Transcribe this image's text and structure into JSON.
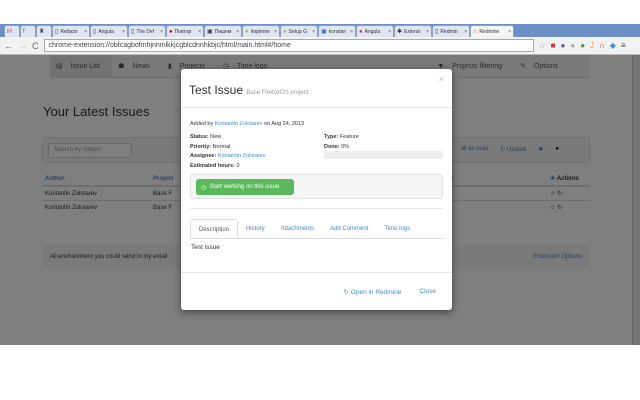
{
  "browser": {
    "tabs": [
      {
        "label": "",
        "icon": "M",
        "color": "#d44"
      },
      {
        "label": "",
        "icon": "f",
        "color": "#3b5998"
      },
      {
        "label": "",
        "icon": "♜",
        "color": "#335"
      },
      {
        "label": "Refacto",
        "icon": "▯"
      },
      {
        "label": "Angula",
        "icon": "▯"
      },
      {
        "label": "The Def",
        "icon": "▯"
      },
      {
        "label": "Повтор",
        "icon": "●",
        "color": "#c00"
      },
      {
        "label": "Пишем",
        "icon": "▣"
      },
      {
        "label": "Impleme",
        "icon": "●",
        "color": "#8c4"
      },
      {
        "label": "Setup G",
        "icon": "●",
        "color": "#8c4"
      },
      {
        "label": "konstan",
        "icon": "▣",
        "color": "#36c"
      },
      {
        "label": "Angula",
        "icon": "●",
        "color": "#c33"
      },
      {
        "label": "Extensi",
        "icon": "✱"
      },
      {
        "label": "Redmin",
        "icon": "▯"
      },
      {
        "label": "Redmine",
        "icon": "∩",
        "color": "#c33",
        "active": true
      }
    ],
    "url": "chrome-extension://obfcagbofmhjnnmlkkjcgblcdnnhkbjc/html/main.html#/home"
  },
  "nav": {
    "items": [
      "Issue List",
      "News",
      "Projects",
      "Time logs"
    ],
    "right": [
      "Projects filtering",
      "Options"
    ]
  },
  "page": {
    "title": "Your Latest Issues",
    "search_placeholder": "Search by subject",
    "mark_read": "all as read",
    "update": "Update",
    "columns": [
      "Author",
      "Project",
      "y",
      "Actions"
    ],
    "rows": [
      {
        "author": "Kontantin Zolotarev",
        "project": "Base F"
      },
      {
        "author": "Kontantin Zolotarev",
        "project": "Base F"
      }
    ],
    "footer_text": "All enchantment you could send to my email",
    "footer_link": "Extension Options"
  },
  "modal": {
    "title": "Test Issue",
    "project": "Base FirefoxOS project",
    "added_prefix": "Added by",
    "added_by": "Kontantin Zolotarev",
    "added_suffix": "on Aug 24, 2013",
    "status_label": "Status:",
    "status": "New",
    "priority_label": "Priority:",
    "priority": "Normal",
    "assignee_label": "Assignee:",
    "assignee": "Kontantin Zolotarev",
    "hours_label": "Estimated hours:",
    "hours": "0",
    "type_label": "Type:",
    "type": "Feature",
    "done_label": "Done:",
    "done": "0%",
    "done_value": 0,
    "start_button": "Start working on this issue",
    "tabs": [
      "Description",
      "History",
      "Attachments",
      "Add Comment",
      "Time logs"
    ],
    "description": "Test issue",
    "open_button": "Open in Redmine",
    "close_button": "Close"
  }
}
